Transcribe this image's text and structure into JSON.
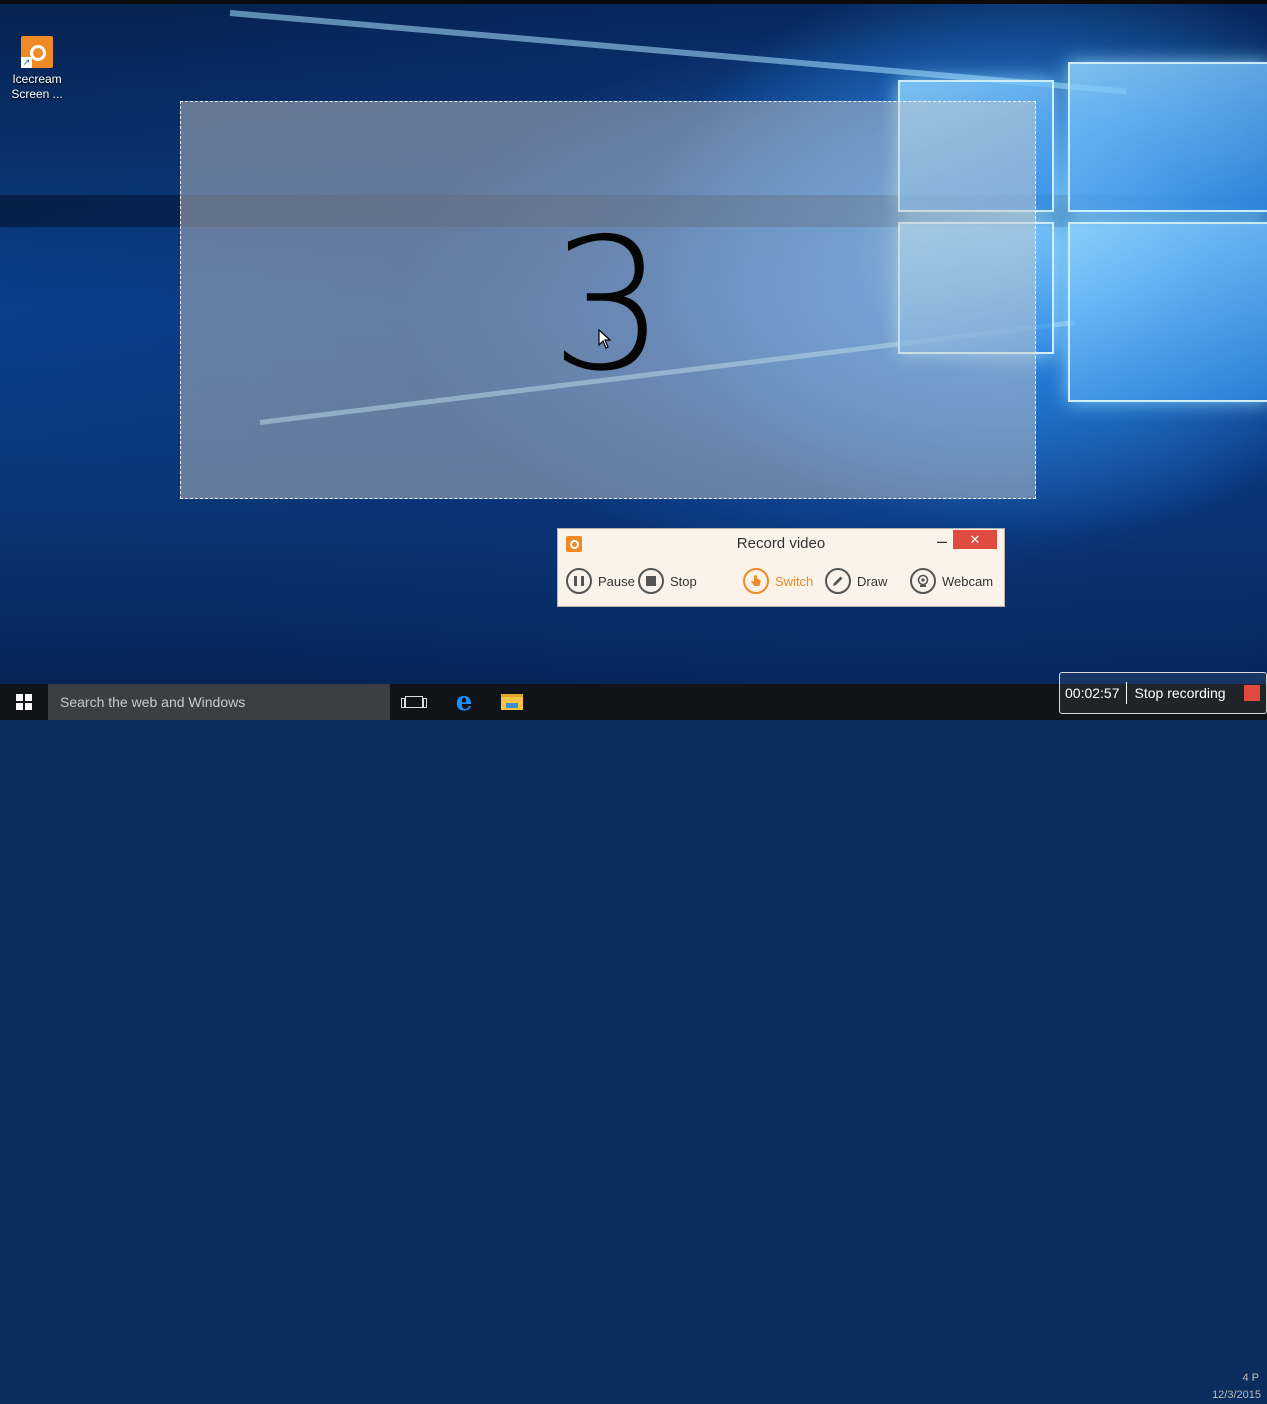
{
  "desktop": {
    "icon": {
      "label_line1": "Icecream",
      "label_line2": "Screen ..."
    }
  },
  "capture": {
    "countdown": "3"
  },
  "recorder": {
    "title": "Record video",
    "minimize_glyph": "–",
    "close_glyph": "✕",
    "buttons": {
      "pause": "Pause",
      "stop": "Stop",
      "switch": "Switch",
      "draw": "Draw",
      "webcam": "Webcam"
    },
    "accent_color": "#f08a24",
    "close_color": "#e04a3f"
  },
  "taskbar": {
    "search_placeholder": "Search the web and Windows",
    "edge_glyph": "e"
  },
  "tray": {
    "time_fragment": "4 P",
    "date": "12/3/2015"
  },
  "stop_bar": {
    "timer": "00:02:57",
    "label": "Stop recording"
  }
}
